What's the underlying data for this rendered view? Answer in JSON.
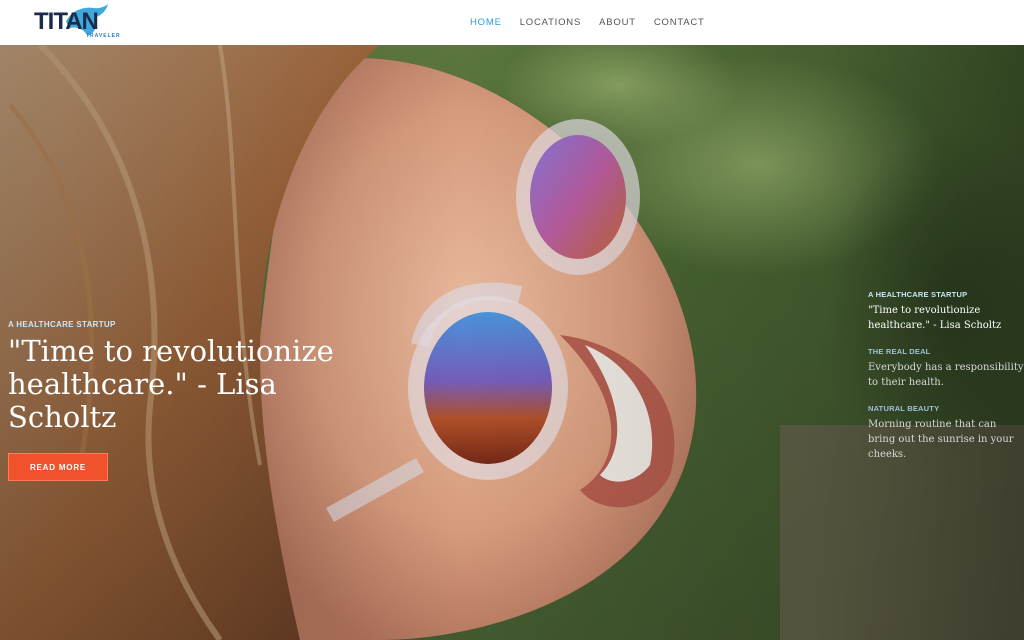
{
  "brand": {
    "name": "TITAN",
    "tagline": "TRAVELER"
  },
  "nav": {
    "items": [
      {
        "label": "HOME"
      },
      {
        "label": "LOCATIONS"
      },
      {
        "label": "ABOUT"
      },
      {
        "label": "CONTACT"
      }
    ],
    "active_index": 0
  },
  "hero": {
    "eyebrow": "A HEALTHCARE STARTUP",
    "headline": "\"Time to revolutionize healthcare.\" - Lisa Scholtz",
    "cta_label": "READ MORE",
    "image_icon": "hero-photo-smiling-woman-sunglasses"
  },
  "slides": [
    {
      "label": "A HEALTHCARE STARTUP",
      "text": "\"Time to revolutionize healthcare.\" - Lisa Scholtz"
    },
    {
      "label": "THE REAL DEAL",
      "text": "Everybody has a responsibility to their health."
    },
    {
      "label": "NATURAL BEAUTY",
      "text": "Morning routine that can bring out the sunrise in your cheeks."
    }
  ],
  "colors": {
    "accent": "#2a9fd8",
    "cta": "#f0532b",
    "logo_dark": "#1b2b4a"
  }
}
